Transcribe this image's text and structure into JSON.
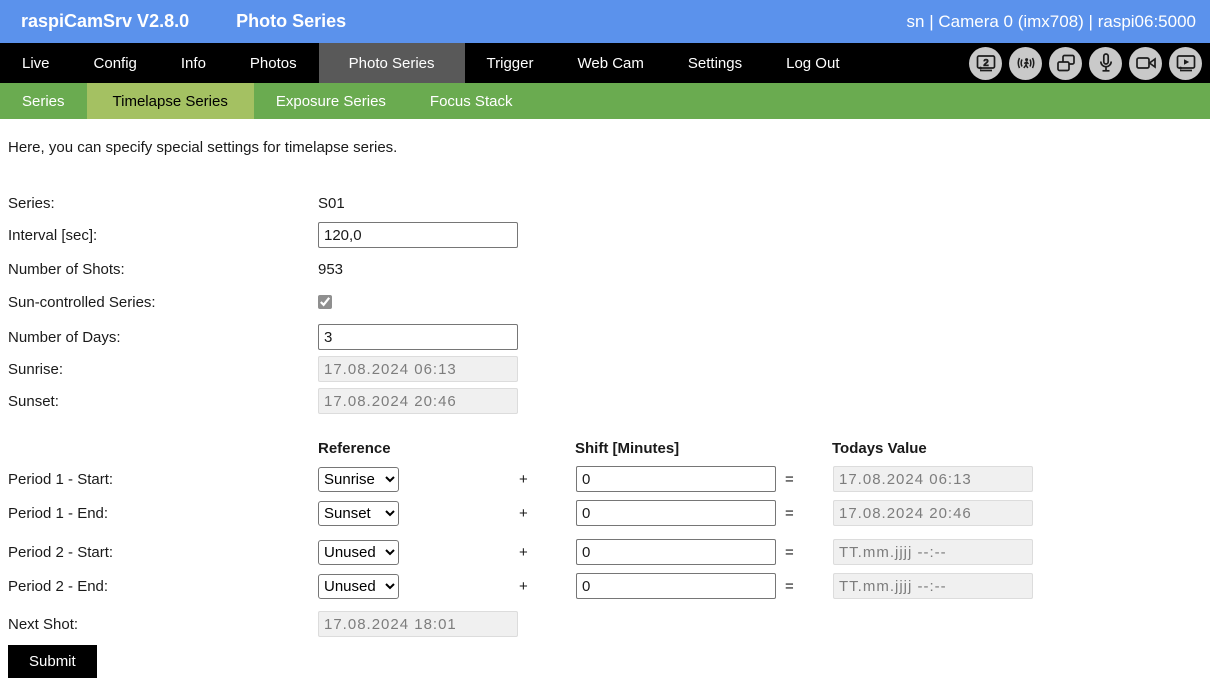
{
  "header": {
    "app_title": "raspiCamSrv V2.8.0",
    "page_title": "Photo Series",
    "status": "sn | Camera 0 (imx708) | raspi06:5000"
  },
  "nav": {
    "items": [
      {
        "label": "Live"
      },
      {
        "label": "Config"
      },
      {
        "label": "Info"
      },
      {
        "label": "Photos"
      },
      {
        "label": "Photo Series",
        "active": true
      },
      {
        "label": "Trigger"
      },
      {
        "label": "Web Cam"
      },
      {
        "label": "Settings"
      },
      {
        "label": "Log Out"
      }
    ],
    "icons": [
      "display-2-icon",
      "motion-broadcast-icon",
      "photo-stack-icon",
      "microphone-icon",
      "video-camera-icon",
      "player-screen-icon"
    ]
  },
  "subnav": {
    "items": [
      {
        "label": "Series"
      },
      {
        "label": "Timelapse Series",
        "active": true
      },
      {
        "label": "Exposure Series"
      },
      {
        "label": "Focus Stack"
      }
    ]
  },
  "intro": "Here, you can specify special settings for timelapse series.",
  "form": {
    "series": {
      "label": "Series:",
      "value": "S01"
    },
    "interval": {
      "label": "Interval [sec]:",
      "value": "120,0"
    },
    "number_of_shots": {
      "label": "Number of Shots:",
      "value": "953"
    },
    "sun_controlled": {
      "label": "Sun-controlled Series:",
      "checked": true
    },
    "number_of_days": {
      "label": "Number of Days:",
      "value": "3"
    },
    "sunrise": {
      "label": "Sunrise:",
      "value": "17.08.2024 06:13"
    },
    "sunset": {
      "label": "Sunset:",
      "value": "17.08.2024 20:46"
    },
    "table_headers": {
      "reference": "Reference",
      "shift": "Shift [Minutes]",
      "todays_value": "Todays Value"
    },
    "operators": {
      "plus": "+",
      "equals": "="
    },
    "periods": [
      {
        "label": "Period 1 - Start:",
        "reference": "Sunrise",
        "shift": "0",
        "todays_value": "17.08.2024 06:13"
      },
      {
        "label": "Period 1 - End:",
        "reference": "Sunset",
        "shift": "0",
        "todays_value": "17.08.2024 20:46"
      },
      {
        "label": "Period 2 - Start:",
        "reference": "Unused",
        "shift": "0",
        "todays_value": "TT.mm.jjjj --:--"
      },
      {
        "label": "Period 2 - End:",
        "reference": "Unused",
        "shift": "0",
        "todays_value": "TT.mm.jjjj --:--"
      }
    ],
    "next_shot": {
      "label": "Next Shot:",
      "value": "17.08.2024 18:01"
    },
    "submit_label": "Submit"
  },
  "colors": {
    "header_bg": "#5b92ec",
    "nav_bg": "#000000",
    "nav_active_bg": "#595959",
    "subnav_bg": "#6aab50",
    "subnav_active_bg": "#a4c162",
    "submit_bg": "#000000",
    "icon_circle_bg": "#c9c9c9"
  }
}
